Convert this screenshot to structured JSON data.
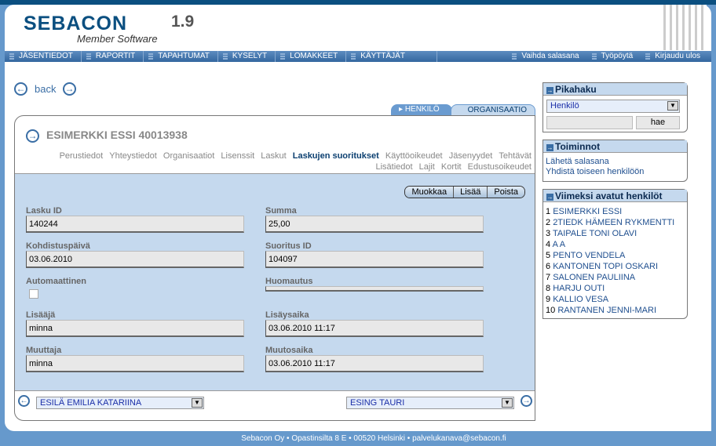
{
  "app": {
    "logo": "SEBACON",
    "version": "1.9",
    "tagline": "Member Software"
  },
  "nav": {
    "items": [
      "JÄSENTIEDOT",
      "RAPORTIT",
      "TAPAHTUMAT",
      "KYSELYT",
      "LOMAKKEET",
      "KÄYTTÄJÄT"
    ],
    "right": [
      "Vaihda salasana",
      "Työpöytä",
      "Kirjaudu ulos"
    ]
  },
  "back_label": "back",
  "type_tabs": {
    "active": "HENKILÖ",
    "other": "ORGANISAATIO"
  },
  "record": {
    "title": "ESIMERKKI ESSI 40013938"
  },
  "subtabs": [
    "Perustiedot",
    "Yhteystiedot",
    "Organisaatiot",
    "Lisenssit",
    "Laskut",
    "Laskujen suoritukset",
    "Käyttöoikeudet",
    "Jäsenyydet",
    "Tehtävät",
    "Lisätiedot",
    "Lajit",
    "Kortit",
    "Edustusoikeudet"
  ],
  "active_subtab": "Laskujen suoritukset",
  "actions": [
    "Muokkaa",
    "Lisää",
    "Poista"
  ],
  "fields": {
    "lasku_id": {
      "label": "Lasku ID",
      "value": "140244"
    },
    "summa": {
      "label": "Summa",
      "value": "25,00"
    },
    "kohdistuspaiva": {
      "label": "Kohdistuspäivä",
      "value": "03.06.2010"
    },
    "suoritus_id": {
      "label": "Suoritus ID",
      "value": "104097"
    },
    "automaattinen": {
      "label": "Automaattinen",
      "checked": false
    },
    "huomautus": {
      "label": "Huomautus",
      "value": ""
    },
    "lisaaja": {
      "label": "Lisääjä",
      "value": "minna"
    },
    "lisaysaika": {
      "label": "Lisäysaika",
      "value": "03.06.2010 11:17"
    },
    "muuttaja": {
      "label": "Muuttaja",
      "value": "minna"
    },
    "muutosaika": {
      "label": "Muutosaika",
      "value": "03.06.2010 11:17"
    }
  },
  "pager": {
    "prev": "ESILÄ EMILIA KATARIINA",
    "next": "ESING TAURI"
  },
  "pikahaku": {
    "title": "Pikahaku",
    "select": "Henkilö",
    "input": "",
    "button": "hae"
  },
  "toiminnot": {
    "title": "Toiminnot",
    "items": [
      "Lähetä salasana",
      "Yhdistä toiseen henkilöön"
    ]
  },
  "recent": {
    "title": "Viimeksi avatut henkilöt",
    "items": [
      {
        "n": "1",
        "name": "ESIMERKKI ESSI"
      },
      {
        "n": "2",
        "name": "2TIEDK HÄMEEN RYKMENTTI"
      },
      {
        "n": "3",
        "name": "TAIPALE TONI OLAVI"
      },
      {
        "n": "4",
        "name": "A A"
      },
      {
        "n": "5",
        "name": "PENTO VENDELA"
      },
      {
        "n": "6",
        "name": "KANTONEN TOPI OSKARI"
      },
      {
        "n": "7",
        "name": "SALONEN PAULIINA"
      },
      {
        "n": "8",
        "name": "HARJU OUTI"
      },
      {
        "n": "9",
        "name": "KALLIO VESA"
      },
      {
        "n": "10",
        "name": "RANTANEN JENNI-MARI"
      }
    ]
  },
  "footer": "Sebacon Oy • Opastinsilta 8 E • 00520 Helsinki • palvelukanava@sebacon.fi",
  "colors": {
    "brand": "#0b4f80",
    "panel": "#c5d9ee",
    "link": "#1f4f8f"
  }
}
